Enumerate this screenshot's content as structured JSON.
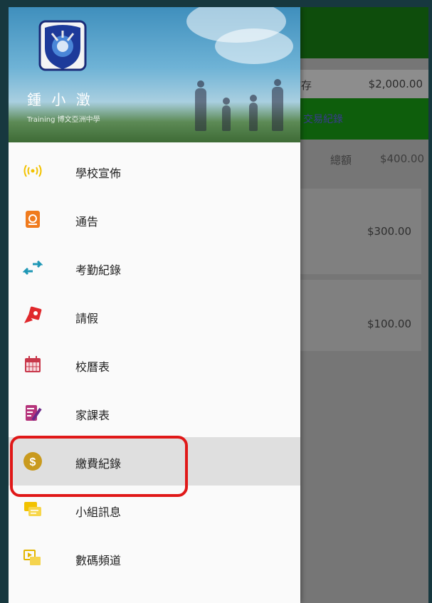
{
  "background_app": {
    "balance_label": "結存",
    "balance_value": "$2,000.00",
    "tab_label": "交易紀錄",
    "total_label": "總額",
    "total_value": "$400.00",
    "records": [
      {
        "amount": "$300.00"
      },
      {
        "amount": "$100.00"
      }
    ]
  },
  "drawer": {
    "user_name": "鍾 小 澂",
    "school_name": "Training 博文亞洲中學",
    "menu": [
      {
        "label": "學校宣佈",
        "icon": "broadcast-icon"
      },
      {
        "label": "通告",
        "icon": "notice-icon"
      },
      {
        "label": "考勤紀錄",
        "icon": "attendance-arrows-icon"
      },
      {
        "label": "請假",
        "icon": "leave-icon"
      },
      {
        "label": "校曆表",
        "icon": "calendar-icon"
      },
      {
        "label": "家課表",
        "icon": "homework-icon"
      },
      {
        "label": "繳費紀錄",
        "icon": "dollar-coin-icon",
        "selected": true
      },
      {
        "label": "小組訊息",
        "icon": "group-message-icon"
      },
      {
        "label": "數碼頻道",
        "icon": "digital-channel-icon"
      }
    ]
  },
  "colors": {
    "app_bar": "#0e4d0c",
    "highlight": "#e01818"
  }
}
